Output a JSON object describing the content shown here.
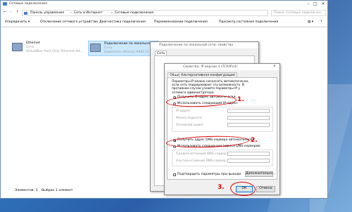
{
  "window": {
    "title": "Сетевые подключения",
    "breadcrumb": [
      "Панель управления",
      "Сеть и Интернет",
      "Сетевые подключения"
    ],
    "search_placeholder": "Поиск: Сетевые подключен",
    "toolbar": [
      "Упорядочить ▾",
      "Отключение сетевого устройства",
      "Диагностика подключения",
      "Переименование подключения",
      "Просмотр состояния подключения"
    ]
  },
  "connections": [
    {
      "name": "Ethernet",
      "line2": "Сеть",
      "line3": "VirtualBox Host-Only Ethernet Ad..."
    },
    {
      "name": "Подключение по локальной сети",
      "line2": "Сеть",
      "line3": "Qualcomm Atheros AR8131 PCI..."
    }
  ],
  "status": {
    "elements": "Элементов: 3",
    "selected": "Выбран 1 элемент"
  },
  "props_dialog": {
    "title": "Подключение по локальной сети: свойства",
    "tab": "Сеть"
  },
  "ipv4_dialog": {
    "title": "Свойства: IP версии 4 (TCP/IPv4)",
    "tabs": [
      "Общие",
      "Альтернативная конфигурация"
    ],
    "intro": "Параметры IP можно назначать автоматически, если сеть поддерживает эту возможность. В противном случае узнайте параметры IP у сетевого администратора.",
    "radio_auto_ip": "Получить IP-адрес автоматически",
    "radio_manual_ip": "Использовать следующий IP-адрес:",
    "ip_fields": [
      "IP-адрес:",
      "Маска подсети:",
      "Основной шлюз:"
    ],
    "radio_auto_dns": "Получить адрес DNS-сервера автоматически",
    "radio_manual_dns": "Использовать следующие адреса DNS-серверов:",
    "dns_fields": [
      "Предпочитаемый DNS-сервер:",
      "Альтернативный DNS-сервер:"
    ],
    "validate": "Подтвердить параметры при выходе",
    "advanced": "Дополнительно...",
    "ok": "ОК",
    "cancel": "Отмена"
  },
  "annotations": [
    "1.",
    "2.",
    "3."
  ],
  "colors": {
    "annotation": "#e00000",
    "desktop": "#2f6fb8"
  }
}
